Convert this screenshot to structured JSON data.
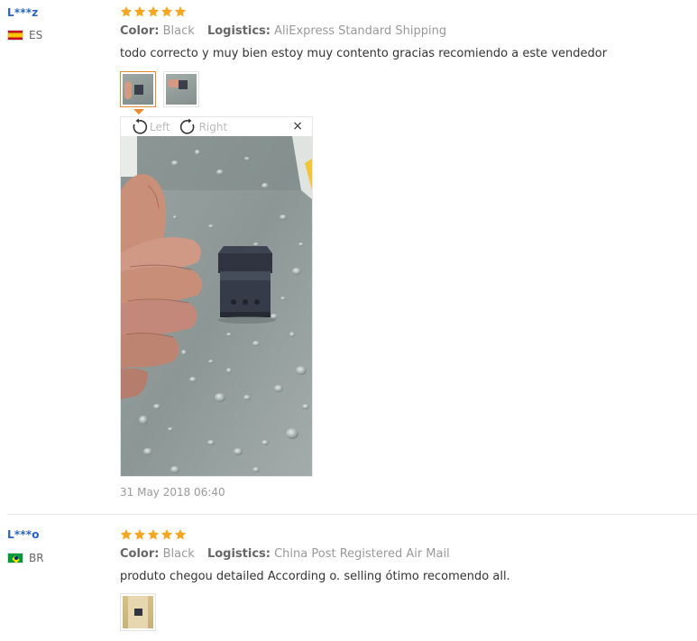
{
  "reviews": [
    {
      "user": "L***z",
      "country_code": "ES",
      "rating": 5,
      "color_label": "Color:",
      "color_value": "Black",
      "logistics_label": "Logistics:",
      "logistics_value": "AliExpress Standard Shipping",
      "text": "todo correcto y muy bien estoy muy contento gracias recomiendo a este vendedor",
      "date": "31 May 2018 06:40"
    },
    {
      "user": "L***o",
      "country_code": "BR",
      "rating": 5,
      "color_label": "Color:",
      "color_value": "Black",
      "logistics_label": "Logistics:",
      "logistics_value": "China Post Registered Air Mail",
      "text": "produto chegou detailed According o. selling ótimo recomendo all."
    }
  ],
  "viewer": {
    "rotate_left_label": "Left",
    "rotate_right_label": "Right",
    "close_symbol": "×"
  },
  "icons": {
    "star": "star-icon",
    "rotate_left": "rotate-left-icon",
    "rotate_right": "rotate-right-icon",
    "close": "close-icon"
  },
  "colors": {
    "star": "#f5a623",
    "username": "#2b63c8",
    "active_thumb_border": "#e58a2f"
  }
}
